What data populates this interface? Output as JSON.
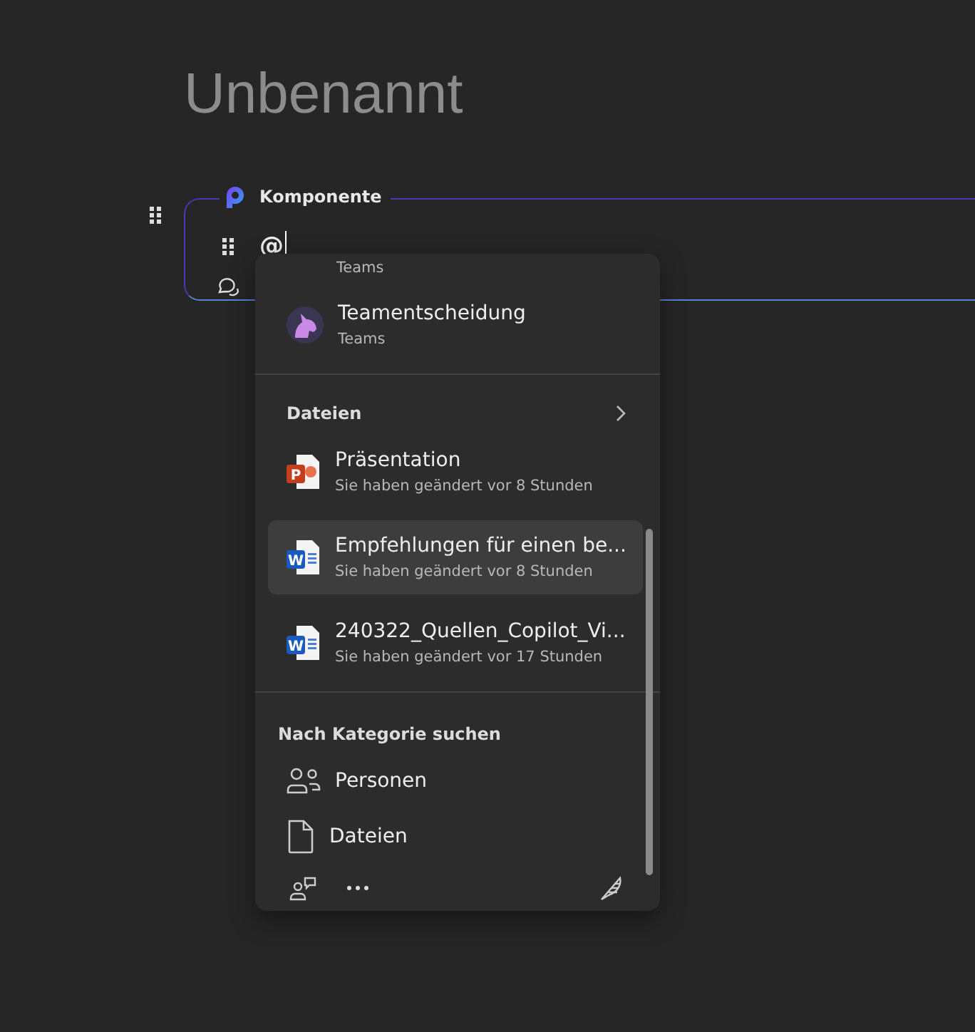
{
  "title": "Unbenannt",
  "component": {
    "label": "Komponente",
    "input": "@"
  },
  "suggestions": {
    "clipped_item": {
      "subtitle": "Teams"
    },
    "people": [
      {
        "name": "Teamentscheidung",
        "subtitle": "Teams"
      }
    ],
    "files_section": {
      "heading": "Dateien",
      "files": [
        {
          "kind": "powerpoint",
          "app_letter": "P",
          "name": "Präsentation",
          "subtitle": "Sie haben geändert vor 8 Stunden",
          "selected": false
        },
        {
          "kind": "word",
          "app_letter": "W",
          "name": "Empfehlungen für einen be...",
          "subtitle": "Sie haben geändert vor 8 Stunden",
          "selected": true
        },
        {
          "kind": "word",
          "app_letter": "W",
          "name": "240322_Quellen_Copilot_Vi...",
          "subtitle": "Sie haben geändert vor 17 Stunden",
          "selected": false
        }
      ]
    },
    "category_section": {
      "heading": "Nach Kategorie suchen",
      "items": [
        {
          "kind": "people",
          "label": "Personen"
        },
        {
          "kind": "files",
          "label": "Dateien"
        }
      ]
    }
  }
}
